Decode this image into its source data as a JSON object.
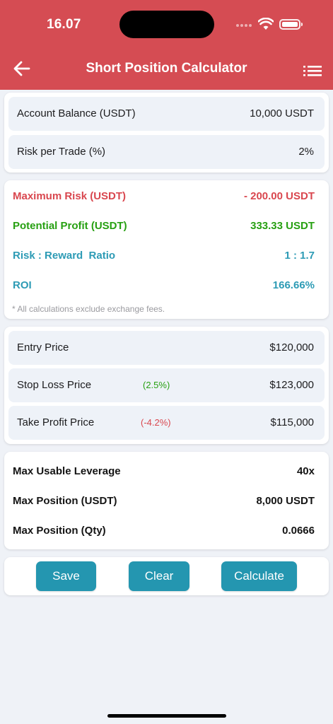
{
  "status_bar": {
    "time": "16.07"
  },
  "header": {
    "title": "Short Position Calculator"
  },
  "inputs": {
    "account_balance": {
      "label": "Account Balance (USDT)",
      "value": "10,000 USDT"
    },
    "risk_per_trade": {
      "label": "Risk per Trade (%)",
      "value": "2%"
    }
  },
  "results": {
    "max_risk": {
      "label": "Maximum Risk (USDT)",
      "value": "- 200.00 USDT"
    },
    "potential_profit": {
      "label": "Potential Profit (USDT)",
      "value": "333.33 USDT"
    },
    "risk_reward": {
      "label": "Risk : Reward  Ratio",
      "value": "1 : 1.7"
    },
    "roi": {
      "label": "ROI",
      "value": "166.66%"
    },
    "note": "* All calculations exclude exchange fees."
  },
  "prices": {
    "entry": {
      "label": "Entry Price",
      "value": "$120,000"
    },
    "stop_loss": {
      "label": "Stop Loss Price",
      "pct": "(2.5%)",
      "value": "$123,000"
    },
    "take_profit": {
      "label": "Take Profit Price",
      "pct": "(-4.2%)",
      "value": "$115,000"
    }
  },
  "leverage": {
    "max_leverage": {
      "label": "Max Usable Leverage",
      "value": "40x"
    },
    "max_position_usdt": {
      "label": "Max Position (USDT)",
      "value": "8,000 USDT"
    },
    "max_position_qty": {
      "label": "Max Position (Qty)",
      "value": "0.0666"
    }
  },
  "actions": {
    "save": "Save",
    "clear": "Clear",
    "calculate": "Calculate"
  },
  "colors": {
    "header_bg": "#d54c53",
    "loss_red": "#d9474f",
    "profit_green": "#27a012",
    "info_teal": "#2d9bb5",
    "button_bg": "#2496b0"
  }
}
